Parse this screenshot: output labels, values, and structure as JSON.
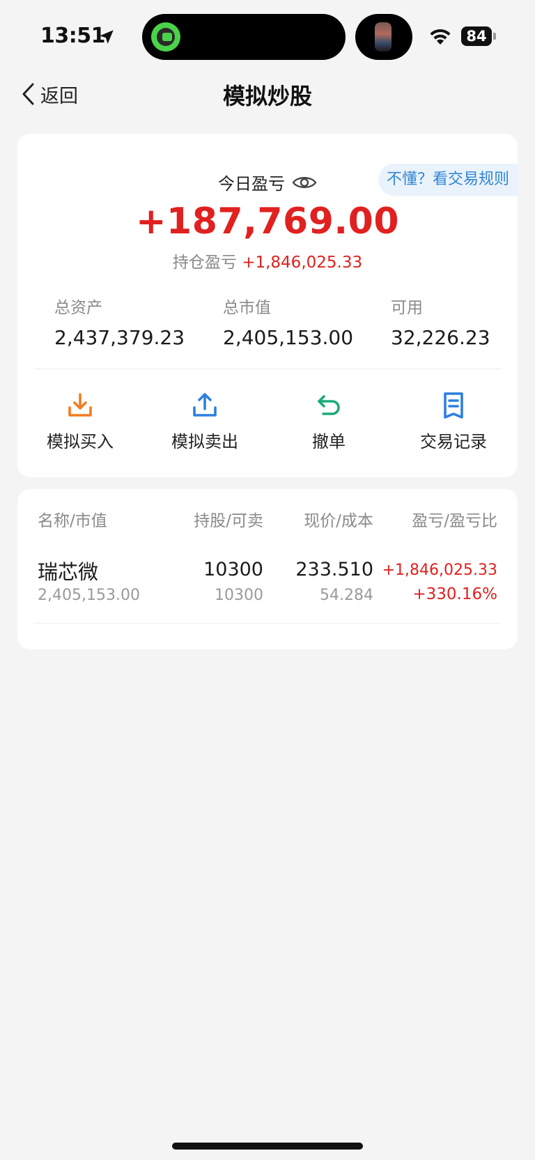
{
  "status_bar": {
    "time": "13:51",
    "battery": "84"
  },
  "nav": {
    "back_label": "返回",
    "title": "模拟炒股"
  },
  "summary": {
    "rules_link": "不懂？看交易规则",
    "today_pnl_label": "今日盈亏",
    "today_pnl_value": "+187,769.00",
    "holding_pnl_label": "持仓盈亏",
    "holding_pnl_value": "+1,846,025.33",
    "stats": [
      {
        "label": "总资产",
        "value": "2,437,379.23"
      },
      {
        "label": "总市值",
        "value": "2,405,153.00"
      },
      {
        "label": "可用",
        "value": "32,226.23"
      }
    ],
    "actions": [
      {
        "label": "模拟买入",
        "icon": "download-icon",
        "color": "#f47b20"
      },
      {
        "label": "模拟卖出",
        "icon": "upload-icon",
        "color": "#2d7fe0"
      },
      {
        "label": "撤单",
        "icon": "undo-icon",
        "color": "#1aab7a"
      },
      {
        "label": "交易记录",
        "icon": "document-icon",
        "color": "#2d7fe0"
      }
    ]
  },
  "holdings": {
    "headers": [
      "名称/市值",
      "持股/可卖",
      "现价/成本",
      "盈亏/盈亏比"
    ],
    "rows": [
      {
        "name": "瑞芯微",
        "market_value": "2,405,153.00",
        "shares": "10300",
        "available": "10300",
        "price": "233.510",
        "cost": "54.284",
        "pnl": "+1,846,025.33",
        "pnl_ratio": "+330.16%"
      }
    ]
  },
  "colors": {
    "up_red": "#e0211f",
    "link_blue": "#2f86d4",
    "page_bg": "#f4f4f4"
  }
}
